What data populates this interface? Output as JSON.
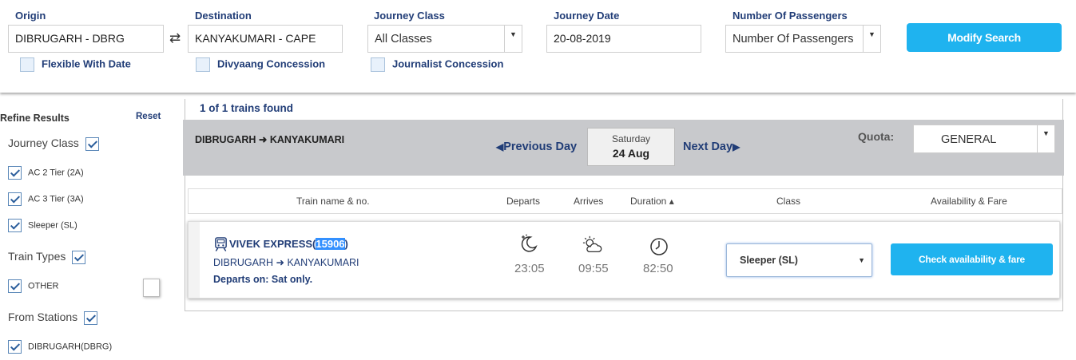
{
  "search": {
    "origin_label": "Origin",
    "origin_value": "DIBRUGARH - DBRG",
    "destination_label": "Destination",
    "destination_value": "KANYAKUMARI - CAPE",
    "class_label": "Journey Class",
    "class_value": "All Classes",
    "date_label": "Journey Date",
    "date_value": "20-08-2019",
    "passengers_label": "Number Of Passengers",
    "passengers_value": "Number Of Passengers",
    "flexible_label": "Flexible With Date",
    "divyaang_label": "Divyaang Concession",
    "journalist_label": "Journalist Concession",
    "modify_button": "Modify Search",
    "swap_icon": "⇄"
  },
  "sidebar": {
    "title": "Refine Results",
    "reset": "Reset",
    "journey_class_heading": "Journey Class",
    "journey_classes": [
      "AC 2 Tier (2A)",
      "AC 3 Tier (3A)",
      "Sleeper (SL)"
    ],
    "train_types_heading": "Train Types",
    "train_types": [
      "OTHER"
    ],
    "from_stations_heading": "From Stations",
    "from_stations": [
      "DIBRUGARH(DBRG)"
    ]
  },
  "results": {
    "found_text": "1 of 1 trains found",
    "route_from": "DIBRUGARH",
    "route_to": "KANYAKUMARI",
    "prev_day": "Previous Day",
    "next_day": "Next Day",
    "day_of_week": "Saturday",
    "day_month": "24 Aug",
    "quota_label": "Quota:",
    "quota_value": "GENERAL",
    "columns": {
      "train": "Train name & no.",
      "departs": "Departs",
      "arrives": "Arrives",
      "duration": "Duration ▴",
      "class": "Class",
      "availability": "Availability & Fare"
    }
  },
  "train": {
    "name": "VIVEK EXPRESS",
    "number": "15906",
    "from": "DIBRUGARH",
    "to": "KANYAKUMARI",
    "departs_on": "Departs on: Sat only.",
    "depart_time": "23:05",
    "arrive_time": "09:55",
    "duration": "82:50",
    "class_selected": "Sleeper (SL)",
    "check_button": "Check availability & fare"
  },
  "colors": {
    "navy": "#213d77",
    "accent": "#1fb3ef",
    "strip": "#c8c9cc"
  }
}
